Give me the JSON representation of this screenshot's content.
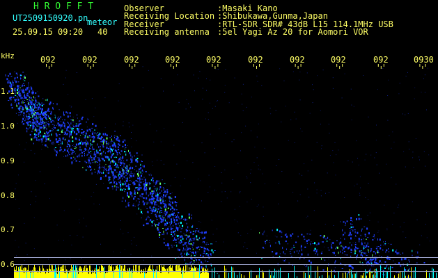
{
  "header": {
    "app_title": "H R O F F T",
    "file_name": "UT2509150920.pn",
    "file_suffix": "meteor",
    "datetime": "25.09.15 09:20",
    "value": "40",
    "info": [
      {
        "label": "Observer",
        "value": ":Masaki Kano"
      },
      {
        "label": "Receiving Location",
        "value": ":Shibukawa,Gunma,Japan"
      },
      {
        "label": "Receiver",
        "value": ":RTL-SDR SDR# 43dB L15 114.1MHz USB"
      },
      {
        "label": "Receiving antenna",
        "value": ":5el Yagi Az 20 for Aomori VOR"
      }
    ]
  },
  "axis": {
    "y_unit": "kHz",
    "y_ticks": [
      "1.1",
      "1.0",
      "0.9",
      "0.8",
      "0.7",
      "0.6"
    ],
    "x_ticks": [
      "092",
      "092",
      "092",
      "092",
      "092",
      "092",
      "092",
      "092",
      "092",
      "0930"
    ]
  },
  "colors": {
    "background": "#000000",
    "text_yellow": "#ffff66",
    "text_green": "#33ff33",
    "text_cyan": "#33ffff",
    "signal_blue": "#2040ff",
    "signal_cyan": "#00ffff",
    "noise_yellow": "#ffff00"
  }
}
